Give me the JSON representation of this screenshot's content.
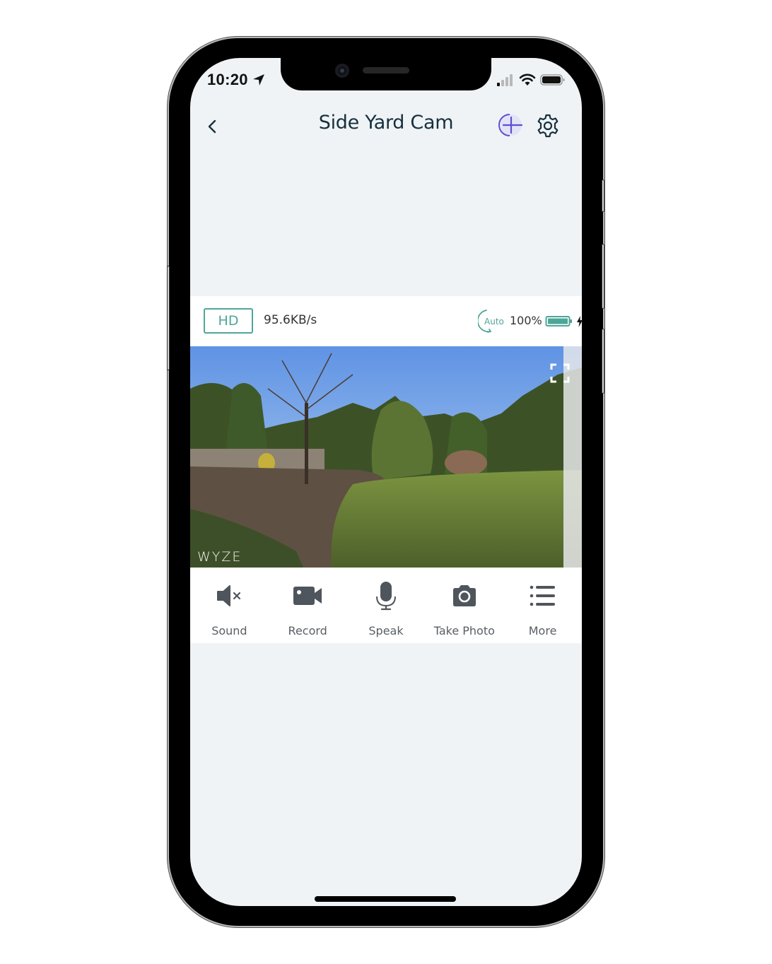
{
  "status_bar": {
    "time": "10:20",
    "location_icon": "location-arrow-icon",
    "signal_icon": "cellular-signal-icon",
    "wifi_icon": "wifi-icon",
    "battery_icon": "battery-icon"
  },
  "nav": {
    "back_icon": "chevron-left-icon",
    "title": "Side Yard Cam",
    "add_icon": "add-circle-icon",
    "settings_icon": "gear-icon"
  },
  "info_bar": {
    "quality": "HD",
    "speed": "95.6KB/s",
    "night_mode_label": "Auto",
    "battery_percent": "100%",
    "battery_level": 1.0,
    "charging": true
  },
  "video": {
    "watermark": "WYZE",
    "fullscreen_icon": "fullscreen-icon"
  },
  "controls": [
    {
      "label": "Sound",
      "icon": "speaker-muted-icon"
    },
    {
      "label": "Record",
      "icon": "video-camera-icon"
    },
    {
      "label": "Speak",
      "icon": "microphone-icon"
    },
    {
      "label": "Take Photo",
      "icon": "camera-icon"
    },
    {
      "label": "More",
      "icon": "list-icon"
    }
  ],
  "colors": {
    "accent_teal": "#4ea699",
    "accent_purple": "#5b4fd6",
    "title": "#17303d",
    "background": "#eff3f6",
    "icon_gray": "#4f555c"
  }
}
